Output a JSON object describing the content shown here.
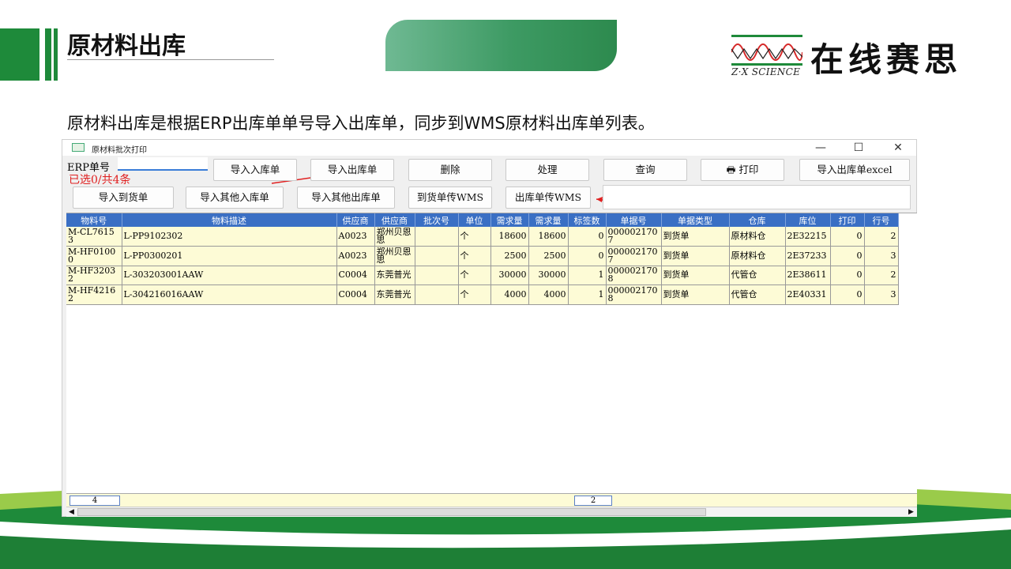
{
  "slide": {
    "title": "原材料出库",
    "description": "原材料出库是根据ERP出库单单号导入出库单，同步到WMS原材料出库单列表。",
    "logo_text": "在线赛思",
    "logo_sub": "Z·X SCIENCE"
  },
  "window": {
    "title": "原材料批次打印",
    "controls": {
      "minimize": "—",
      "maximize": "☐",
      "close": "✕"
    }
  },
  "form": {
    "erp_label": "ERP单号",
    "erp_value": "",
    "selected_note": "已选0/共4条"
  },
  "buttons": {
    "import_inbound": "导入入库单",
    "import_outbound": "导入出库单",
    "delete": "删除",
    "process": "处理",
    "query": "查询",
    "print": "打印",
    "import_outbound_excel": "导入出库单excel",
    "import_arrival": "导入到货单",
    "import_other_inbound": "导入其他入库单",
    "import_other_outbound": "导入其他出库单",
    "arrival_to_wms": "到货单传WMS",
    "outbound_to_wms": "出库单传WMS"
  },
  "table": {
    "columns": [
      "物料号",
      "物料描述",
      "供应商",
      "供应商",
      "批次号",
      "单位",
      "需求量",
      "需求量",
      "标签数",
      "单据号",
      "单据类型",
      "仓库",
      "库位",
      "打印",
      "行号"
    ],
    "rows": [
      [
        "M-CL76153",
        "L-PP9102302",
        "A0023",
        "郑州贝恩思",
        "",
        "个",
        "18600",
        "18600",
        "0",
        "0000021707",
        "到货单",
        "原材料仓",
        "2E32215",
        "0",
        "2"
      ],
      [
        "M-HF01000",
        "L-PP0300201",
        "A0023",
        "郑州贝恩思",
        "",
        "个",
        "2500",
        "2500",
        "0",
        "0000021707",
        "到货单",
        "原材料仓",
        "2E37233",
        "0",
        "3"
      ],
      [
        "M-HF32032",
        "L-303203001AAW",
        "C0004",
        "东莞普光",
        "",
        "个",
        "30000",
        "30000",
        "1",
        "0000021708",
        "到货单",
        "代管仓",
        "2E38611",
        "0",
        "2"
      ],
      [
        "M-HF42162",
        "L-304216016AAW",
        "C0004",
        "东莞普光",
        "",
        "个",
        "4000",
        "4000",
        "1",
        "0000021708",
        "到货单",
        "代管仓",
        "2E40331",
        "0",
        "3"
      ]
    ],
    "footer_count": "4",
    "footer_sum": "2"
  },
  "colors": {
    "brand_green": "#1e8a3a",
    "header_blue": "#3a6fc4",
    "row_yellow": "#fdfbd6",
    "annotation_red": "#e02020"
  }
}
